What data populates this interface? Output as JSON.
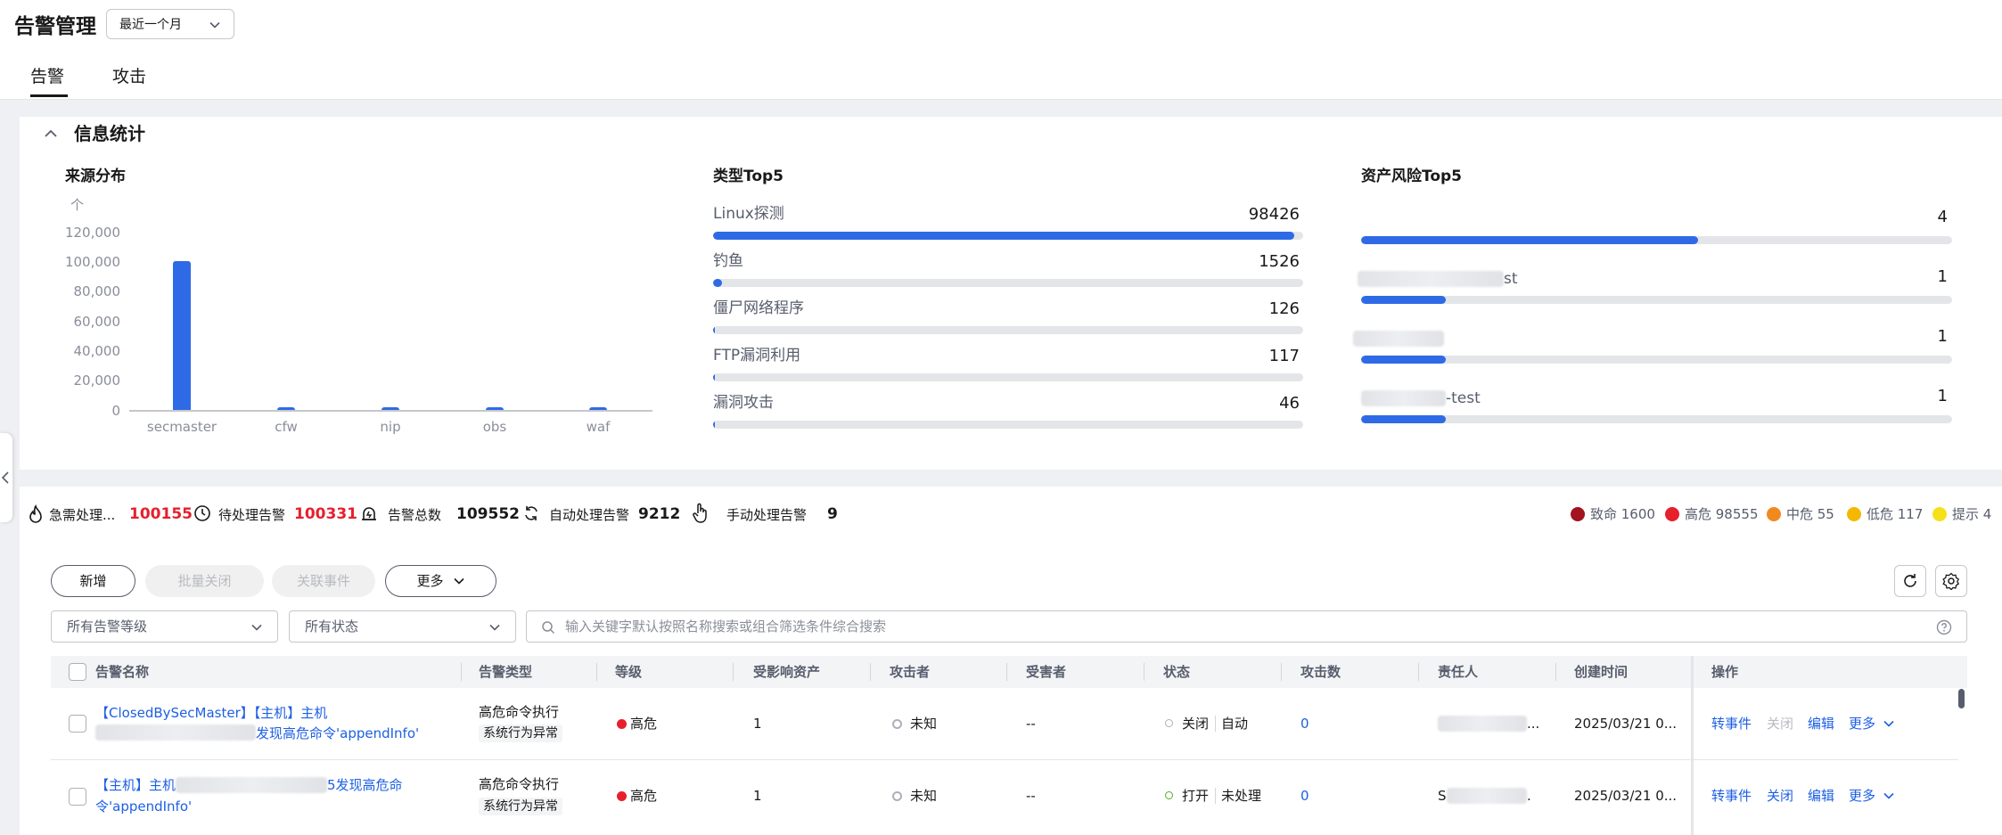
{
  "header": {
    "title": "告警管理",
    "time_range": "最近一个月"
  },
  "tabs": [
    {
      "label": "告警"
    },
    {
      "label": "攻击"
    }
  ],
  "stats": {
    "title": "信息统计",
    "source": {
      "title": "来源分布",
      "unit": "个",
      "y_ticks": [
        "120,000",
        "100,000",
        "80,000",
        "60,000",
        "40,000",
        "20,000",
        "0"
      ],
      "x_ticks": [
        "secmaster",
        "cfw",
        "nip",
        "obs",
        "waf"
      ]
    },
    "type_top5": {
      "title": "类型Top5",
      "items": [
        {
          "name": "Linux探测",
          "value": "98426",
          "ratio": 1.0
        },
        {
          "name": "钓鱼",
          "value": "1526",
          "ratio": 0.0155
        },
        {
          "name": "僵尸网络程序",
          "value": "126",
          "ratio": 0.0013
        },
        {
          "name": "FTP漏洞利用",
          "value": "117",
          "ratio": 0.0012
        },
        {
          "name": "漏洞攻击",
          "value": "46",
          "ratio": 0.0005
        }
      ]
    },
    "asset_top5": {
      "title": "资产风险Top5",
      "items": [
        {
          "name": "",
          "value": "4",
          "ratio": 0.57
        },
        {
          "name": "st",
          "value": "1",
          "ratio": 0.143
        },
        {
          "name": "",
          "value": "1",
          "ratio": 0.143
        },
        {
          "name": "-test",
          "value": "1",
          "ratio": 0.143
        }
      ]
    }
  },
  "chart_data": {
    "type": "bar",
    "title": "来源分布",
    "ylabel": "个",
    "categories": [
      "secmaster",
      "cfw",
      "nip",
      "obs",
      "waf"
    ],
    "values": [
      100000,
      1200,
      900,
      700,
      500
    ],
    "ylim": [
      0,
      120000
    ],
    "grid": false
  },
  "summary": {
    "urgent_label": "急需处理...",
    "urgent_value": "100155",
    "pending_label": "待处理告警",
    "pending_value": "100331",
    "total_label": "告警总数",
    "total_value": "109552",
    "auto_label": "自动处理告警",
    "auto_value": "9212",
    "manual_label": "手动处理告警",
    "manual_value": "9",
    "levels": [
      {
        "label": "致命 1600",
        "color": "#a3121f"
      },
      {
        "label": "高危 98555",
        "color": "#e6202d"
      },
      {
        "label": "中危 55",
        "color": "#f08a1e"
      },
      {
        "label": "低危 117",
        "color": "#f5b800"
      },
      {
        "label": "提示 4",
        "color": "#f5e11a"
      }
    ]
  },
  "toolbar": {
    "add": "新增",
    "batch_close": "批量关闭",
    "link_event": "关联事件",
    "more": "更多"
  },
  "filters": {
    "level": "所有告警等级",
    "status": "所有状态",
    "search_placeholder": "输入关键字默认按照名称搜索或组合筛选条件综合搜索"
  },
  "table": {
    "columns": [
      "告警名称",
      "告警类型",
      "等级",
      "受影响资产",
      "攻击者",
      "受害者",
      "状态",
      "攻击数",
      "责任人",
      "创建时间",
      "操作"
    ],
    "rows": [
      {
        "name_line1": "【ClosedBySecMaster】【主机】主机",
        "name_line2": "发现高危命令'appendInfo'",
        "type": "高危命令执行",
        "type_tag": "系统行为异常",
        "level": "高危",
        "assets": "1",
        "attacker": "未知",
        "victim": "--",
        "status": "关闭",
        "status_tag": "自动",
        "attacks": "0",
        "owner": "...",
        "created": "2025/03/21 0...",
        "ops": [
          "转事件",
          "关闭",
          "编辑",
          "更多"
        ]
      },
      {
        "name_line1": "【主机】主机",
        "name_line1_tail": "5发现高危命",
        "name_line2": "令'appendInfo'",
        "type": "高危命令执行",
        "type_tag": "系统行为异常",
        "level": "高危",
        "assets": "1",
        "attacker": "未知",
        "victim": "--",
        "status": "打开",
        "status_tag": "未处理",
        "attacks": "0",
        "owner_prefix": "S",
        "owner": ".",
        "created": "2025/03/21 0...",
        "ops": [
          "转事件",
          "关闭",
          "编辑",
          "更多"
        ]
      }
    ]
  }
}
